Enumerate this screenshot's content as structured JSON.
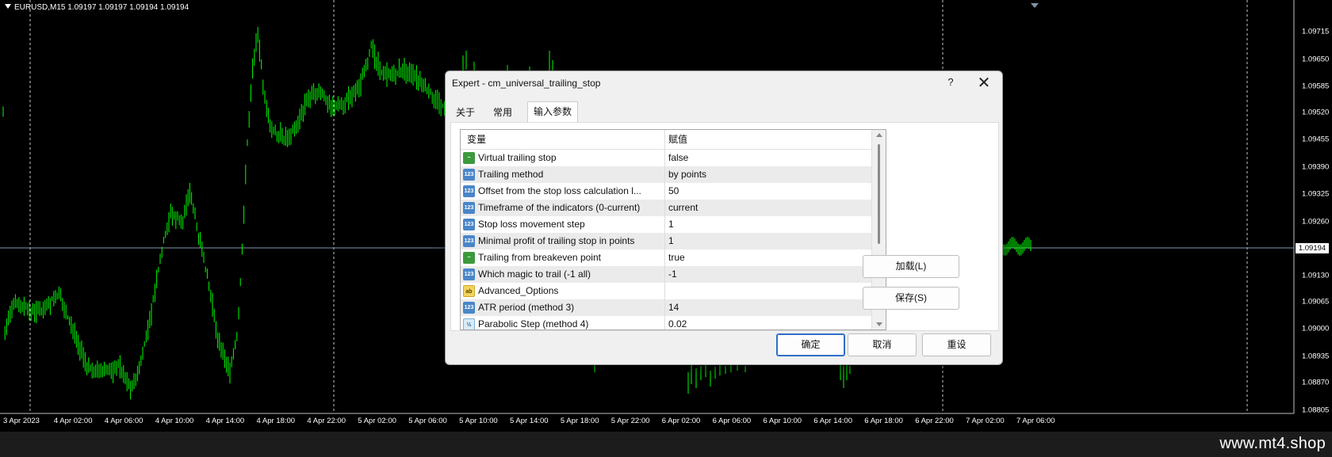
{
  "chart": {
    "title": "EURUSD,M15  1.09197 1.09197 1.09194 1.09194",
    "current_price": "1.09194",
    "price_labels": [
      "1.09715",
      "1.09650",
      "1.09585",
      "1.09520",
      "1.09455",
      "1.09390",
      "1.09325",
      "1.09260",
      "1.09130",
      "1.09065",
      "1.09000",
      "1.08935",
      "1.08870",
      "1.08805"
    ],
    "time_labels": [
      "3 Apr 2023",
      "4 Apr 02:00",
      "4 Apr 06:00",
      "4 Apr 10:00",
      "4 Apr 14:00",
      "4 Apr 18:00",
      "4 Apr 22:00",
      "5 Apr 02:00",
      "5 Apr 06:00",
      "5 Apr 10:00",
      "5 Apr 14:00",
      "5 Apr 18:00",
      "5 Apr 22:00",
      "6 Apr 02:00",
      "6 Apr 06:00",
      "6 Apr 10:00",
      "6 Apr 14:00",
      "6 Apr 18:00",
      "6 Apr 22:00",
      "7 Apr 02:00",
      "7 Apr 06:00"
    ],
    "colors": {
      "background": "#000000",
      "candles": "#00ff00",
      "grid": "#c8c8c8",
      "price_line": "#7f93a6"
    }
  },
  "watermark": "www.mt4.shop",
  "dialog": {
    "title": "Expert - cm_universal_trailing_stop",
    "help_label": "?",
    "close_label": "✕",
    "tabs": [
      {
        "label": "关于",
        "active": false
      },
      {
        "label": "常用",
        "active": false
      },
      {
        "label": "输入参数",
        "active": true
      }
    ],
    "grid": {
      "col_variable": "变量",
      "col_value": "赋值",
      "rows": [
        {
          "icon": "bool-icon",
          "icon_text": "~",
          "name": "Virtual trailing stop",
          "value": "false"
        },
        {
          "icon": "int-icon",
          "icon_text": "123",
          "name": "Trailing method",
          "value": "by points"
        },
        {
          "icon": "int-icon",
          "icon_text": "123",
          "name": "Offset from the stop loss calculation l...",
          "value": "50"
        },
        {
          "icon": "int-icon",
          "icon_text": "123",
          "name": "Timeframe of the indicators (0-current)",
          "value": "current"
        },
        {
          "icon": "int-icon",
          "icon_text": "123",
          "name": "Stop loss movement step",
          "value": "1"
        },
        {
          "icon": "int-icon",
          "icon_text": "123",
          "name": "Minimal profit of trailing stop in points",
          "value": "1"
        },
        {
          "icon": "bool-icon",
          "icon_text": "~",
          "name": "Trailing from breakeven point",
          "value": "true"
        },
        {
          "icon": "int-icon",
          "icon_text": "123",
          "name": "Which magic to trail (-1 all)",
          "value": "-1"
        },
        {
          "icon": "string-icon",
          "icon_text": "ab",
          "name": "Advanced_Options",
          "value": ""
        },
        {
          "icon": "int-icon",
          "icon_text": "123",
          "name": "ATR period (method 3)",
          "value": "14"
        },
        {
          "icon": "double-icon",
          "icon_text": "½",
          "name": "Parabolic Step (method 4)",
          "value": "0.02"
        }
      ]
    },
    "buttons": {
      "load": "加载(L)",
      "save": "保存(S)",
      "ok": "确定",
      "cancel": "取消",
      "reset": "重设"
    }
  }
}
